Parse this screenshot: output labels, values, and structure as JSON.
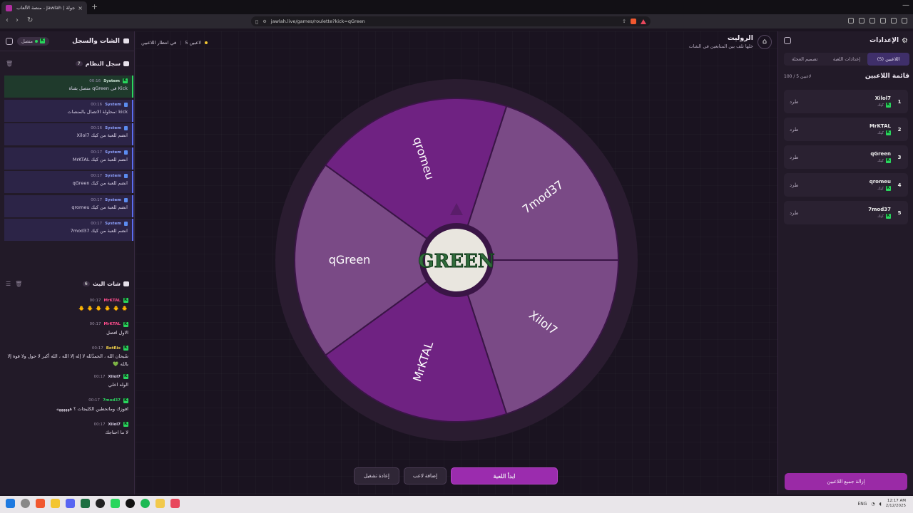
{
  "browser": {
    "tab_title": "جولة | Jawlah - منصة الألعاب التف...",
    "url": "jawlah.live/games/roulette?kick=qGreen"
  },
  "left_panel": {
    "title": "الشات والسجل",
    "connection_status": "متصل",
    "system_log": {
      "title": "سجل النظام",
      "count": "7",
      "entries": [
        {
          "user": "System",
          "time": "00:16",
          "text": "متصل بقناة qGreen في Kick"
        },
        {
          "user": "System",
          "time": "00:16",
          "text": "محاولة الاتصال بالمنصات: kick"
        },
        {
          "user": "System",
          "time": "00:16",
          "text": "Xilol7 انضم للعبة من كيك"
        },
        {
          "user": "System",
          "time": "00:17",
          "text": "MrKTAL انضم للعبة من كيك"
        },
        {
          "user": "System",
          "time": "00:17",
          "text": "qGreen انضم للعبة من كيك"
        },
        {
          "user": "System",
          "time": "00:17",
          "text": "qromeu انضم للعبة من كيك"
        },
        {
          "user": "System",
          "time": "00:17",
          "text": "7mod37 انضم للعبة من كيك"
        }
      ]
    },
    "live_chat": {
      "title": "شات البث",
      "count": "6",
      "messages": [
        {
          "user": "MrKTAL",
          "time": "00:17",
          "text": "🐥 🐥 🐥 🐥 🐥 🐥",
          "color": "#ff4d8d"
        },
        {
          "user": "MrKTAL",
          "time": "00:17",
          "text": "الاول افضل",
          "color": "#ff4d8d"
        },
        {
          "user": "BotRix",
          "time": "00:17",
          "text": "سُبحان الله ، الحمدُلله لا إله إلا الله ، الله أكبر لا حول ولا قوة إلا بالله 💚",
          "color": "#f2d24b"
        },
        {
          "user": "Xilol7",
          "time": "00:17",
          "text": "الوله اخلي",
          "color": "#d8d0e6"
        },
        {
          "user": "7mod37",
          "time": "00:17",
          "text": "افوزك وماتحطين الكليجات ؟ ههههههه",
          "color": "#2bd45f"
        },
        {
          "user": "Xilol7",
          "time": "00:17",
          "text": "لا ما احتاجك",
          "color": "#d8d0e6"
        }
      ]
    }
  },
  "main": {
    "status_players": "5 لاعبين",
    "status_waiting": "في انتظار اللاعبين",
    "game_title": "الروليت",
    "game_subtitle": "خلها تلف بين المتابعين في الشات",
    "center_logo": "GREEN",
    "wheel_segments": [
      {
        "name": "7mod37",
        "color": "#7a4a86"
      },
      {
        "name": "Xilol7",
        "color": "#7a4a86"
      },
      {
        "name": "MrKTAL",
        "color": "#6f2282"
      },
      {
        "name": "qGreen",
        "color": "#7a4a86"
      },
      {
        "name": "qromeu",
        "color": "#6f2282"
      }
    ],
    "buttons": {
      "start": "ابدأ اللعبة",
      "add_player": "إضافة لاعب",
      "restart": "إعادة تشغيل"
    }
  },
  "right_panel": {
    "title": "الإعدادات",
    "tabs": [
      "اللاعبين (5)",
      "إعدادات اللعبة",
      "تصميم العجلة"
    ],
    "players_title": "قائمة اللاعبين",
    "players_cap": "100 / 5 لاعبين",
    "platform_label": "كيك",
    "kick_label": "طرد",
    "players": [
      {
        "num": "1",
        "name": "Xilol7"
      },
      {
        "num": "2",
        "name": "MrKTAL"
      },
      {
        "num": "3",
        "name": "qGreen"
      },
      {
        "num": "4",
        "name": "qromeu"
      },
      {
        "num": "5",
        "name": "7mod37"
      }
    ],
    "clear_all": "إزالة جميع اللاعبين"
  },
  "taskbar": {
    "time": "12:17 AM",
    "date": "2/12/2025",
    "lang": "ENG"
  }
}
